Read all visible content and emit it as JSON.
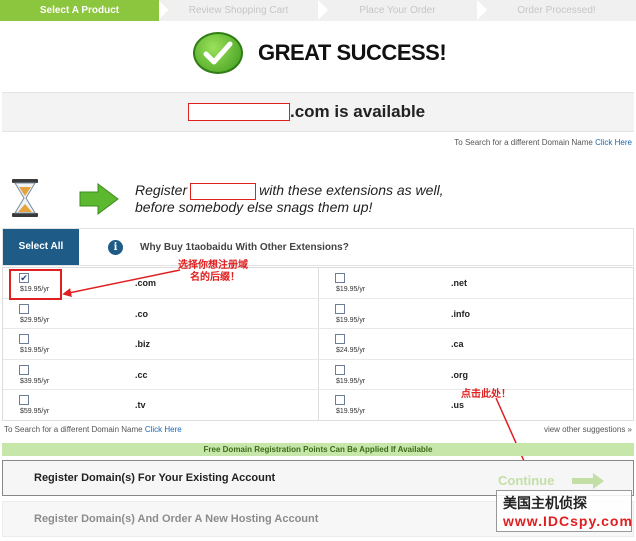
{
  "steps": [
    {
      "label": "Select A Product",
      "active": true
    },
    {
      "label": "Review Shopping Cart",
      "active": false
    },
    {
      "label": "Place Your Order",
      "active": false
    },
    {
      "label": "Order Processed!",
      "active": false
    }
  ],
  "success": {
    "title": "GREAT SUCCESS!"
  },
  "availability": {
    "text": ".com is available"
  },
  "search_note": {
    "text": "To Search for a different Domain Name",
    "link": "Click Here"
  },
  "register_ext": {
    "line1_pre": "Register",
    "line1_post": "with these extensions as well,",
    "line2": "before somebody else snags them up!"
  },
  "table_header": {
    "select_all": "Select All",
    "info": "i",
    "text": "Why Buy 1taobaidu With Other Extensions?"
  },
  "extensions": [
    {
      "ext": ".com",
      "price": "$19.95/yr",
      "checked": true
    },
    {
      "ext": ".net",
      "price": "$19.95/yr",
      "checked": false
    },
    {
      "ext": ".co",
      "price": "$29.95/yr",
      "checked": false
    },
    {
      "ext": ".info",
      "price": "$19.95/yr",
      "checked": false
    },
    {
      "ext": ".biz",
      "price": "$19.95/yr",
      "checked": false
    },
    {
      "ext": ".ca",
      "price": "$24.95/yr",
      "checked": false
    },
    {
      "ext": ".cc",
      "price": "$39.95/yr",
      "checked": false
    },
    {
      "ext": ".org",
      "price": "$19.95/yr",
      "checked": false
    },
    {
      "ext": ".tv",
      "price": "$59.95/yr",
      "checked": false
    },
    {
      "ext": ".us",
      "price": "$19.95/yr",
      "checked": false
    }
  ],
  "annotations": {
    "select_line1": "选择你想注册域",
    "select_line2": "名的后缀！",
    "click_here": "点击此处！"
  },
  "below_grid": {
    "search_text": "To Search for a different Domain Name",
    "search_link": "Click Here",
    "suggestions": "view other suggestions »"
  },
  "free_points": "Free Domain Registration Points Can Be Applied If Available",
  "buttons": {
    "existing": "Register Domain(s) For Your Existing Account",
    "continue": "Continue",
    "new_hosting": "Register Domain(s) And Order A New Hosting Account"
  },
  "watermark": {
    "line1": "美国主机侦探",
    "line2": "www.IDCspy.com"
  },
  "colors": {
    "accent_green": "#8cc63f",
    "select_blue": "#1e5c87",
    "annotation_red": "#e02020",
    "link_blue": "#1a66b3"
  }
}
